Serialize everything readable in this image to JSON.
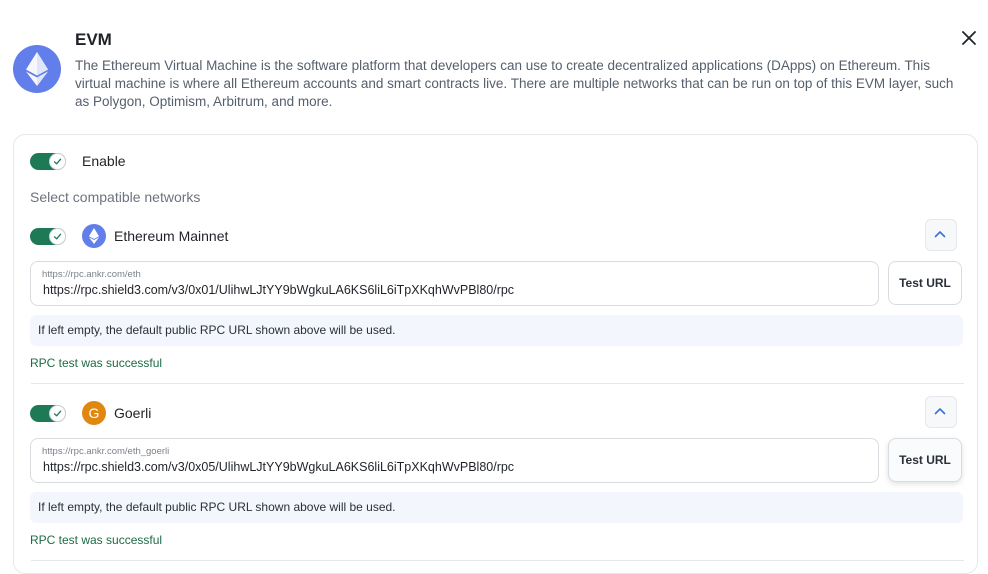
{
  "header": {
    "title": "EVM",
    "description": "The Ethereum Virtual Machine is the software platform that developers can use to create decentralized applications (DApps) on Ethereum. This virtual machine is where all Ethereum accounts and smart contracts live. There are multiple networks that can be run on top of this EVM layer, such as Polygon, Optimism, Arbitrum, and more."
  },
  "enable": {
    "label": "Enable",
    "on": true
  },
  "networks_heading": "Select compatible networks",
  "networks": [
    {
      "name": "Ethereum Mainnet",
      "icon": "ethereum-icon",
      "enabled": true,
      "url_placeholder": "https://rpc.ankr.com/eth",
      "url_value": "https://rpc.shield3.com/v3/0x01/UlihwLJtYY9bWgkuLA6KS6liL6iTpXKqhWvPBl80/rpc",
      "test_label": "Test URL",
      "hint": "If left empty, the default public RPC URL shown above will be used.",
      "status": "RPC test was successful"
    },
    {
      "name": "Goerli",
      "icon_letter": "G",
      "enabled": true,
      "url_placeholder": "https://rpc.ankr.com/eth_goerli",
      "url_value": "https://rpc.shield3.com/v3/0x05/UlihwLJtYY9bWgkuLA6KS6liL6iTpXKqhWvPBl80/rpc",
      "test_label": "Test URL",
      "hint": "If left empty, the default public RPC URL shown above will be used.",
      "status": "RPC test was successful"
    }
  ],
  "colors": {
    "toggle_on": "#1e7a55",
    "eth_blue": "#627eea",
    "goerli_orange": "#e0870f",
    "success": "#1e6b44"
  }
}
